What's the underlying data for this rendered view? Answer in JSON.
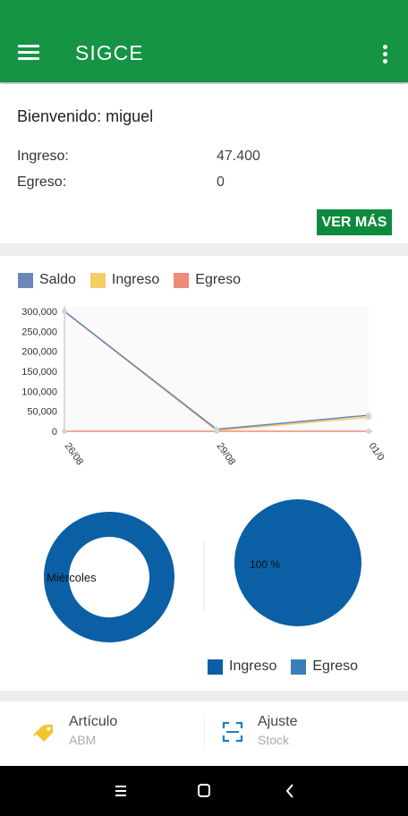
{
  "appbar": {
    "title": "SIGCE",
    "menu_icon": "hamburger-menu-icon",
    "overflow_icon": "more-vert-icon",
    "color": "#159444"
  },
  "summary": {
    "welcome": "Bienvenido: miguel",
    "income_label": "Ingreso:",
    "income_value": "47.400",
    "expense_label": "Egreso:",
    "expense_value": "0",
    "more_button": "VER MÁS"
  },
  "legend": [
    {
      "label": "Saldo",
      "color": "#6b87b7"
    },
    {
      "label": "Ingreso",
      "color": "#f5cd66"
    },
    {
      "label": "Egreso",
      "color": "#ef8b76"
    }
  ],
  "chart_data": [
    {
      "type": "line",
      "x": [
        "26/08",
        "29/08",
        "01/0"
      ],
      "series": [
        {
          "name": "Saldo",
          "values": [
            300000,
            5000,
            40000
          ],
          "color": "#6b87b7"
        },
        {
          "name": "Ingreso",
          "values": [
            300000,
            2000,
            35000
          ],
          "color": "#f5cd66"
        },
        {
          "name": "Egreso",
          "values": [
            0,
            0,
            0
          ],
          "color": "#ef8b76"
        }
      ],
      "yticks": [
        "300,000",
        "250,000",
        "200,000",
        "150,000",
        "100,000",
        "50,000",
        "0"
      ],
      "ylim": [
        0,
        300000
      ],
      "grid": false,
      "legend": "top-left"
    },
    {
      "type": "pie",
      "donut": true,
      "labels": [
        "Miércoles"
      ],
      "values": [
        100
      ],
      "colors": [
        "#0b5fa5"
      ]
    },
    {
      "type": "pie",
      "labels": [
        "Ingreso",
        "Egreso"
      ],
      "values": [
        100,
        0
      ],
      "slice_label": "100 %",
      "colors": [
        "#0b5fa5",
        "#3a7fb8"
      ]
    }
  ],
  "donut_label": "Miércoles",
  "pie_label": "100 %",
  "pie_legend": [
    {
      "label": "Ingreso",
      "color": "#0b5fa5"
    },
    {
      "label": "Egreso",
      "color": "#3a7fb8"
    }
  ],
  "tools": [
    {
      "title": "Artículo",
      "subtitle": "ABM",
      "icon": "tag-icon",
      "icon_color": "#f4c430"
    },
    {
      "title": "Ajuste",
      "subtitle": "Stock",
      "icon": "scan-icon",
      "icon_color": "#1a7fc1"
    }
  ],
  "navbar": {
    "menu_icon": "recents-icon",
    "home_icon": "home-icon",
    "back_icon": "back-icon"
  }
}
